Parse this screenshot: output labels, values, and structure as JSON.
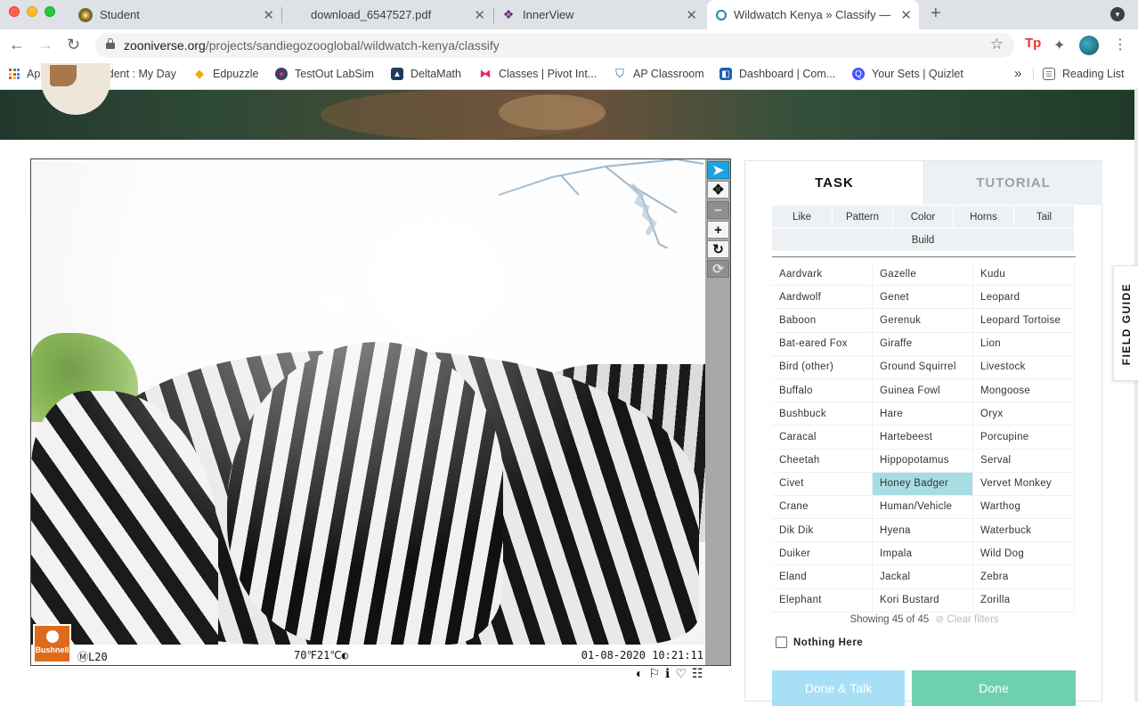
{
  "browser": {
    "tabs": [
      {
        "title": "Student",
        "icon": "student-favicon"
      },
      {
        "title": "download_6547527.pdf",
        "icon": "pdf-favicon"
      },
      {
        "title": "InnerView",
        "icon": "innerview-favicon"
      },
      {
        "title": "Wildwatch Kenya » Classify —",
        "icon": "zooniverse-favicon"
      }
    ],
    "url_domain": "zooniverse.org",
    "url_path": "/projects/sandiegozooglobal/wildwatch-kenya/classify",
    "bookmarks": [
      {
        "label": "Apps"
      },
      {
        "label": "Student : My Day"
      },
      {
        "label": "Edpuzzle"
      },
      {
        "label": "TestOut LabSim"
      },
      {
        "label": "DeltaMath"
      },
      {
        "label": "Classes | Pivot Int..."
      },
      {
        "label": "AP Classroom"
      },
      {
        "label": "Dashboard | Com..."
      },
      {
        "label": "Your Sets | Quizlet"
      }
    ],
    "bookmarks_overflow": "»",
    "reading_list": "Reading List"
  },
  "viewer": {
    "camera_id": "ⓂL20",
    "temperature": "70℉21℃◐",
    "timestamp": "01-08-2020 10:21:11",
    "brand": "Bushnell",
    "tools": [
      "pointer-icon",
      "move-icon",
      "zoom-out-icon",
      "zoom-in-icon",
      "rotate-icon",
      "reset-icon"
    ]
  },
  "panel": {
    "tab_task": "TASK",
    "tab_tutorial": "TUTORIAL",
    "filters_row1": [
      "Like",
      "Pattern",
      "Color",
      "Horns",
      "Tail"
    ],
    "filters_row2": [
      "Build"
    ],
    "choices": [
      "Aardvark",
      "Gazelle",
      "Kudu",
      "Aardwolf",
      "Genet",
      "Leopard",
      "Baboon",
      "Gerenuk",
      "Leopard Tortoise",
      "Bat-eared Fox",
      "Giraffe",
      "Lion",
      "Bird (other)",
      "Ground Squirrel",
      "Livestock",
      "Buffalo",
      "Guinea Fowl",
      "Mongoose",
      "Bushbuck",
      "Hare",
      "Oryx",
      "Caracal",
      "Hartebeest",
      "Porcupine",
      "Cheetah",
      "Hippopotamus",
      "Serval",
      "Civet",
      "Honey Badger",
      "Vervet Monkey",
      "Crane",
      "Human/Vehicle",
      "Warthog",
      "Dik Dik",
      "Hyena",
      "Waterbuck",
      "Duiker",
      "Impala",
      "Wild Dog",
      "Eland",
      "Jackal",
      "Zebra",
      "Elephant",
      "Kori Bustard",
      "Zorilla"
    ],
    "selected_choice": "Honey Badger",
    "showing": "Showing 45 of 45",
    "clear_filters": "Clear filters",
    "nothing_here": "Nothing Here",
    "done_talk": "Done & Talk",
    "done": "Done"
  },
  "field_guide": "FIELD GUIDE"
}
